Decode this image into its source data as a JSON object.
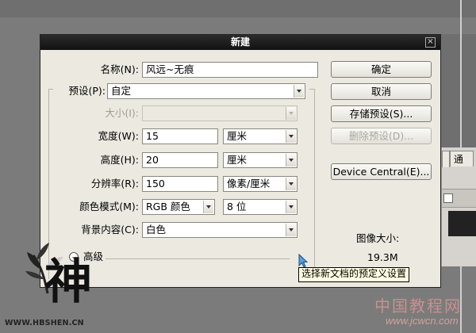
{
  "dialog": {
    "title": "新建"
  },
  "form": {
    "name_label": "名称(N):",
    "name_value": "风远~无痕",
    "preset_label": "预设(P):",
    "preset_value": "自定",
    "size_label": "大小(I):",
    "size_value": "",
    "width_label": "宽度(W):",
    "width_value": "15",
    "width_unit": "厘米",
    "height_label": "高度(H):",
    "height_value": "20",
    "height_unit": "厘米",
    "resolution_label": "分辨率(R):",
    "resolution_value": "150",
    "resolution_unit": "像素/厘米",
    "color_mode_label": "颜色模式(M):",
    "color_mode_value": "RGB 颜色",
    "bit_depth_value": "8 位",
    "background_label": "背景内容(C):",
    "background_value": "白色",
    "advanced_label": "高级"
  },
  "buttons": {
    "ok": "确定",
    "cancel": "取消",
    "save_preset": "存储预设(S)...",
    "delete_preset": "删除预设(D)...",
    "device_central": "Device Central(E)..."
  },
  "image_size": {
    "label": "图像大小:",
    "value": "19.3M"
  },
  "tooltip": "选择新文档的预定义设置",
  "background_panel": {
    "tab_label": "通"
  },
  "watermarks": {
    "logo_char": "神",
    "logo_url": "WWW.HBSHEN.CN",
    "site_name": "中国教程网",
    "site_url": "www.jcwcn.com"
  },
  "colors": {
    "dialog_bg": "#ece9e1",
    "titlebar": "#1a1a1a",
    "desktop": "#7b7b7b"
  }
}
